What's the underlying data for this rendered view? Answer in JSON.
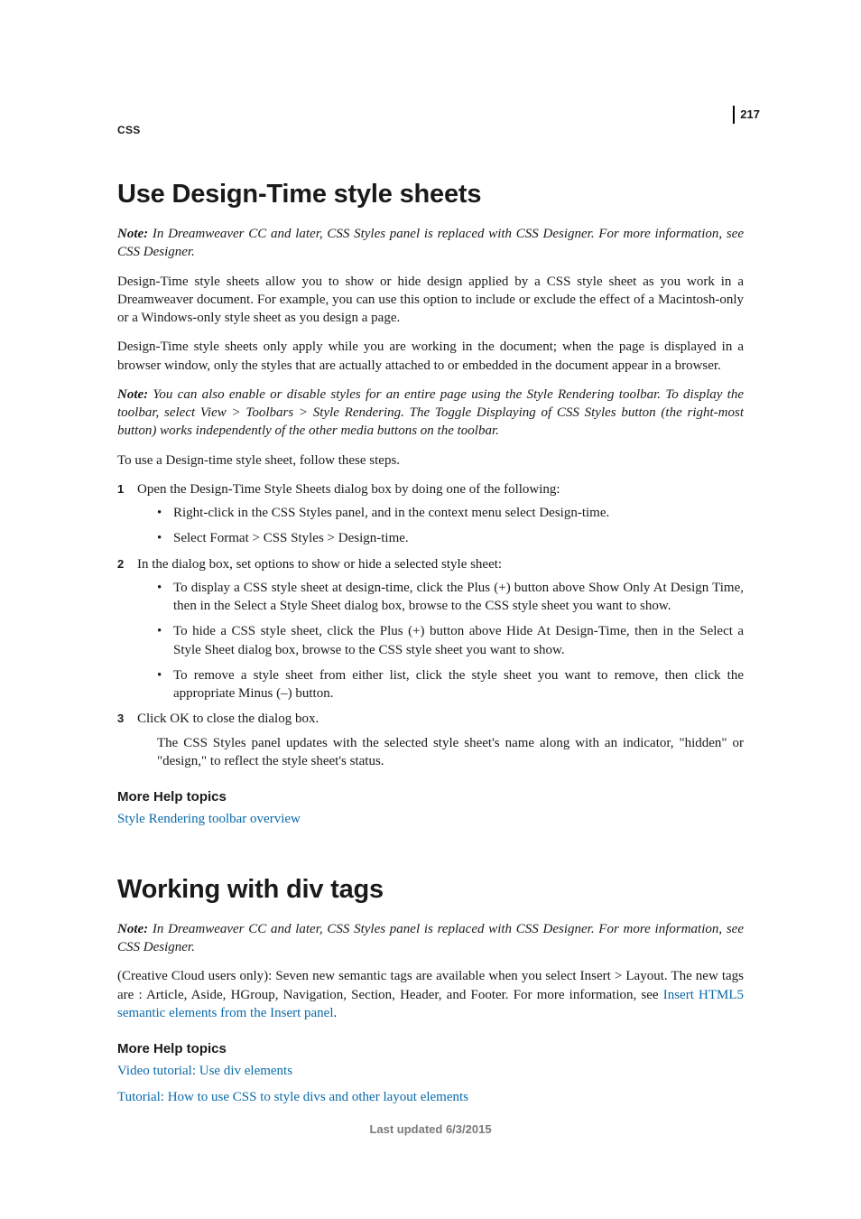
{
  "header": {
    "running_head": "CSS",
    "page_number": "217"
  },
  "section1": {
    "title": "Use Design-Time style sheets",
    "note1_label": "Note:",
    "note1_text": " In Dreamweaver CC and later, CSS Styles panel is replaced with CSS Designer. For more information, see CSS Designer.",
    "p1": "Design-Time style sheets allow you to show or hide design applied by a CSS style sheet as you work in a Dreamweaver document. For example, you can use this option to include or exclude the effect of a Macintosh-only or a Windows-only style sheet as you design a page.",
    "p2": "Design-Time style sheets only apply while you are working in the document; when the page is displayed in a browser window, only the styles that are actually attached to or embedded in the document appear in a browser.",
    "note2_label": "Note:",
    "note2_text": " You can also enable or disable styles for an entire page using the Style Rendering toolbar. To display the toolbar, select View > Toolbars > Style Rendering. The Toggle Displaying of CSS Styles button (the right-most button) works independently of the other media buttons on the toolbar.",
    "p3": "To use a Design-time style sheet, follow these steps.",
    "step1": "Open the Design-Time Style Sheets dialog box by doing one of the following:",
    "step1_b1": "Right-click in the CSS Styles panel, and in the context menu select Design-time.",
    "step1_b2": "Select Format > CSS Styles > Design-time.",
    "step2": "In the dialog box, set options to show or hide a selected style sheet:",
    "step2_b1": "To display a CSS style sheet at design-time, click the Plus (+) button above Show Only At Design Time, then in the Select a Style Sheet dialog box, browse to the CSS style sheet you want to show.",
    "step2_b2": "To hide a CSS style sheet, click the Plus (+) button above Hide At Design-Time, then in the Select a Style Sheet dialog box, browse to the CSS style sheet you want to show.",
    "step2_b3": "To remove a style sheet from either list, click the style sheet you want to remove, then click the appropriate Minus (–) button.",
    "step3": "Click OK to close the dialog box.",
    "step3_sub": "The CSS Styles panel updates with the selected style sheet's name along with an indicator, \"hidden\" or \"design,\" to reflect the style sheet's status.",
    "more_help": "More Help topics",
    "link1": "Style Rendering toolbar overview"
  },
  "section2": {
    "title": "Working with div tags",
    "note1_label": "Note:",
    "note1_text": " In Dreamweaver CC and later, CSS Styles panel is replaced with CSS Designer. For more information, see CSS Designer.",
    "p1_a": "(Creative Cloud users only): Seven new semantic tags are available when you select Insert > Layout. The new tags are : Article, Aside, HGroup, Navigation, Section, Header, and Footer. For more information, see ",
    "p1_link": "Insert HTML5 semantic elements from the Insert panel",
    "p1_b": ".",
    "more_help": "More Help topics",
    "link1": "Video tutorial: Use div elements",
    "link2": "Tutorial: How to use CSS to style divs and other layout elements"
  },
  "footer": {
    "text": "Last updated 6/3/2015"
  }
}
